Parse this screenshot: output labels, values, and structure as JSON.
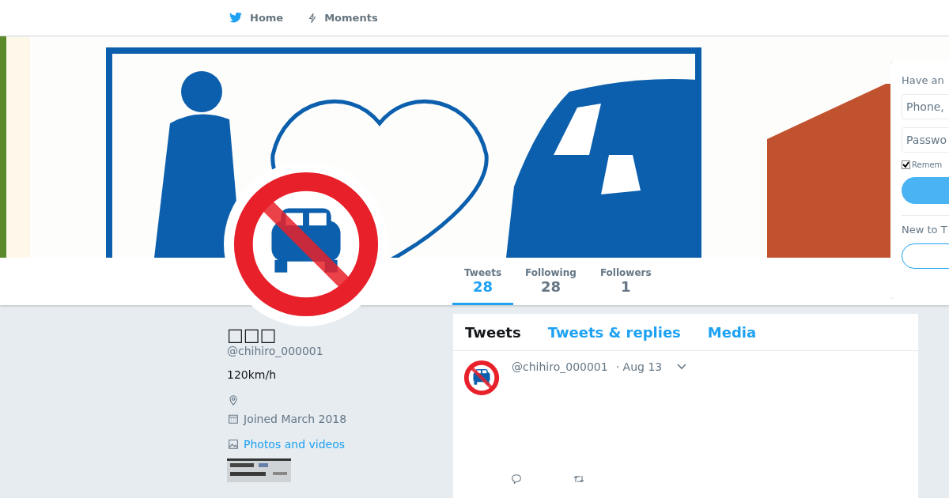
{
  "nav": {
    "items": [
      {
        "label": "Home",
        "selected": false
      },
      {
        "label": "Moments",
        "selected": false
      }
    ]
  },
  "stats": [
    {
      "label": "Tweets",
      "value": "28",
      "selected": true
    },
    {
      "label": "Following",
      "value": "28",
      "selected": false
    },
    {
      "label": "Followers",
      "value": "1",
      "selected": false
    }
  ],
  "profile": {
    "name": "□□□",
    "handle": "@chihiro_000001",
    "bio": "120km/h",
    "joined": "Joined March 2018",
    "photos_link": "Photos and videos"
  },
  "timeline_tabs": [
    {
      "label": "Tweets",
      "selected": true
    },
    {
      "label": "Tweets & replies",
      "selected": false
    },
    {
      "label": "Media",
      "selected": false
    }
  ],
  "tweets": [
    {
      "handle": "@chihiro_000001",
      "date": "· Aug 13"
    }
  ],
  "login": {
    "title": "Have an",
    "phone_placeholder": "Phone,",
    "password_placeholder": "Passwo",
    "remember": {
      "label": "Remem",
      "checked": true
    },
    "signup_prompt": "New to T"
  }
}
